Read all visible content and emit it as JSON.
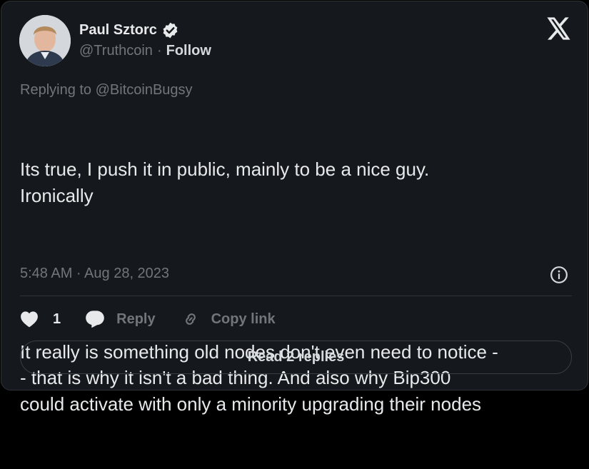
{
  "author": {
    "name": "Paul Sztorc",
    "handle": "@Truthcoin",
    "separator": "·",
    "follow_label": "Follow"
  },
  "replying_to": "Replying to @BitcoinBugsy",
  "tweet": {
    "paragraphs": [
      "Its true, I push it in public, mainly to be a nice guy.\nIronically",
      "It really is something old nodes don't even need to notice -\n- that is why it isn't a bad thing. And also why Bip300\ncould activate with only a minority upgrading their nodes"
    ]
  },
  "timestamp": "5:48 AM · Aug 28, 2023",
  "actions": {
    "like_count": "1",
    "reply_label": "Reply",
    "copy_link_label": "Copy link"
  },
  "read_replies_label": "Read 2 replies",
  "colors": {
    "background": "#15181c",
    "border": "#2f3336",
    "text_primary": "#e7e9ea",
    "text_secondary": "#71767b"
  },
  "icons": [
    "verified-badge-icon",
    "x-logo-icon",
    "info-icon",
    "heart-icon",
    "reply-bubble-icon",
    "link-icon"
  ]
}
